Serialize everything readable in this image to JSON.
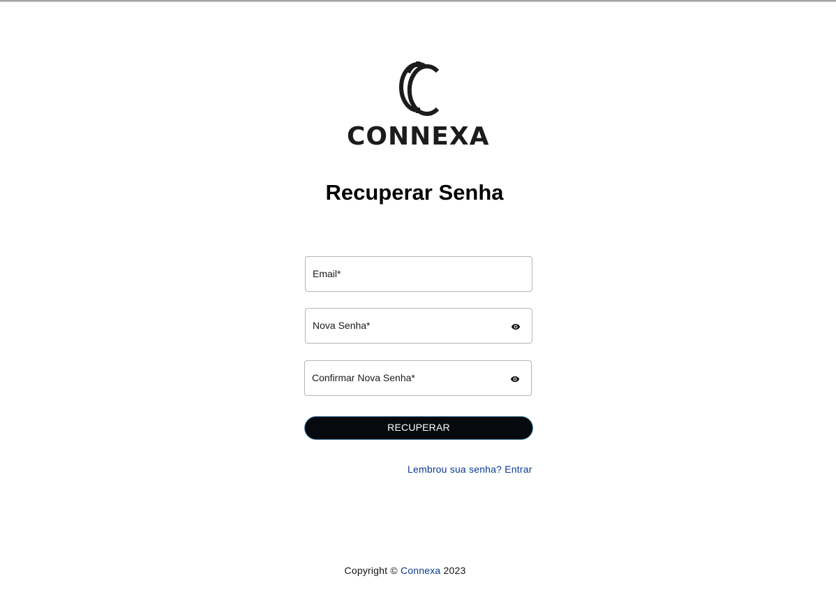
{
  "brand": {
    "logo_text": "CONNEXA",
    "icon": "connexa-cc-logo-mark"
  },
  "page": {
    "title": "Recuperar Senha"
  },
  "form": {
    "email_label": "Email*",
    "new_password_label": "Nova Senha*",
    "confirm_password_label": "Confirmar Nova Senha*",
    "visibility_icon": "eye-icon",
    "submit_label": "RECUPERAR",
    "login_link": "Lembrou sua senha? Entrar"
  },
  "footer": {
    "prefix": "Copyright ©",
    "brand": "Connexa",
    "year": "2023"
  },
  "colors": {
    "button_bg": "#060a0e",
    "button_border": "#4a8aa8",
    "link": "#0a3a8f",
    "logo": "#1c1c1c"
  }
}
